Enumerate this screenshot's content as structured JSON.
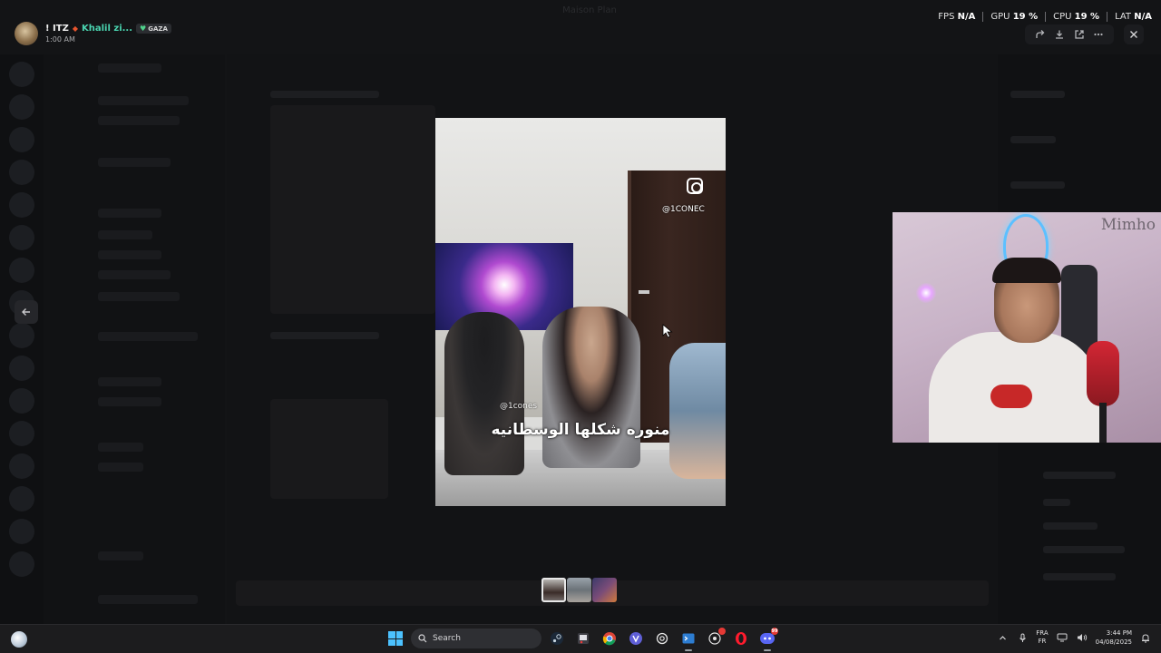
{
  "window": {
    "title": "Maison Plan"
  },
  "user": {
    "name_prefix": "! ITZ",
    "name_suffix": "Khalil zi...",
    "badge": "GAZA",
    "time": "1:00 AM"
  },
  "perf": {
    "fps_label": "FPS",
    "fps_value": "N/A",
    "gpu_label": "GPU",
    "gpu_value": "19 %",
    "cpu_label": "CPU",
    "cpu_value": "19 %",
    "lat_label": "LAT",
    "lat_value": "N/A"
  },
  "viewer_actions": [
    "forward-icon",
    "download-icon",
    "open-external-icon",
    "more-icon",
    "close-icon"
  ],
  "media": {
    "ig_handle": "@1CONEC",
    "watermark": "@1cones",
    "caption": "منوره شكلها الوسطانيه"
  },
  "webcam": {
    "brand": "Mimho"
  },
  "thumbnails": [
    "thumb-1",
    "thumb-2",
    "thumb-3"
  ],
  "taskbar": {
    "search_placeholder": "Search",
    "lang_top": "FRA",
    "lang_bottom": "FR",
    "time": "3:44 PM",
    "date": "04/08/2025",
    "discord_badge": "99"
  },
  "colors": {
    "accent_teal": "#4ad4b0",
    "status_dot": "#e8552e",
    "windows_blue": "#4cc2ff"
  }
}
